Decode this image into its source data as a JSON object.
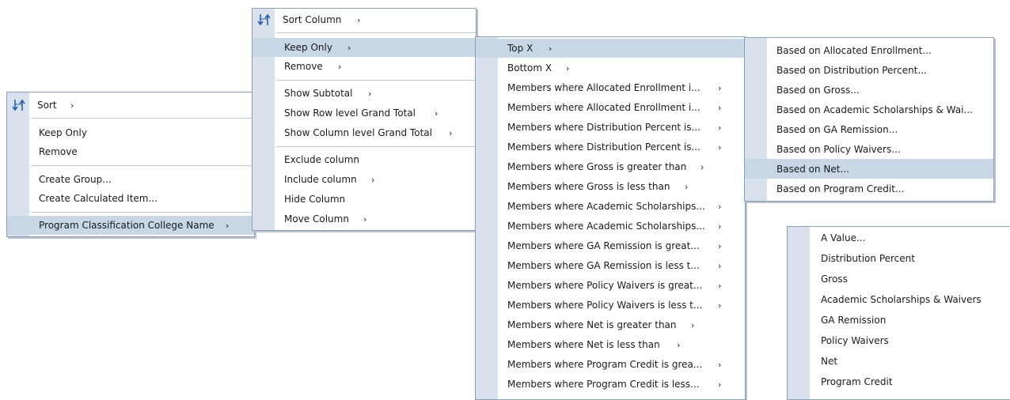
{
  "menu1": {
    "items": [
      {
        "label": "Sort",
        "arrow": true
      },
      {
        "label": "Keep Only",
        "arrow": false
      },
      {
        "label": "Remove",
        "arrow": false
      },
      {
        "label": "Create Group...",
        "arrow": false
      },
      {
        "label": "Create Calculated Item...",
        "arrow": false
      },
      {
        "label": "Program Classification College Name",
        "arrow": true
      }
    ]
  },
  "menu2": {
    "items": [
      {
        "label": "Sort Column"
      },
      {
        "label": "Keep Only"
      },
      {
        "label": "Remove"
      },
      {
        "label": "Show Subtotal"
      },
      {
        "label": "Show Row level Grand Total"
      },
      {
        "label": "Show Column level Grand Total"
      },
      {
        "label": "Exclude column"
      },
      {
        "label": "Include column"
      },
      {
        "label": "Hide Column"
      },
      {
        "label": "Move Column"
      }
    ]
  },
  "menu3": {
    "items": [
      "Top X",
      "Bottom X",
      "Members where Allocated Enrollment i...",
      "Members where Allocated Enrollment i...",
      "Members where Distribution Percent is...",
      "Members where Distribution Percent is...",
      "Members where Gross is greater than",
      "Members where Gross is less than",
      "Members where Academic Scholarships...",
      "Members where Academic Scholarships...",
      "Members where GA Remission is great...",
      "Members where GA Remission is less t...",
      "Members where Policy Waivers is great...",
      "Members where Policy Waivers is less t...",
      "Members where Net is greater than",
      "Members where Net is less than",
      "Members where Program Credit is grea...",
      "Members where Program Credit is less..."
    ]
  },
  "menu4": {
    "items": [
      "Based on Allocated Enrollment...",
      "Based on Distribution Percent...",
      "Based on Gross...",
      "Based on Academic Scholarships & Wai...",
      "Based on GA Remission...",
      "Based on Policy Waivers...",
      "Based on Net...",
      "Based on Program Credit..."
    ]
  },
  "menu5": {
    "items": [
      "A Value...",
      "Distribution Percent",
      "Gross",
      "Academic Scholarships & Waivers",
      "GA Remission",
      "Policy Waivers",
      "Net",
      "Program Credit"
    ]
  },
  "arrow_glyph": "›",
  "colors": {
    "highlight": "#c8d6e5",
    "gutter": "#d9e2ec",
    "icon": "#2b5ea8"
  }
}
